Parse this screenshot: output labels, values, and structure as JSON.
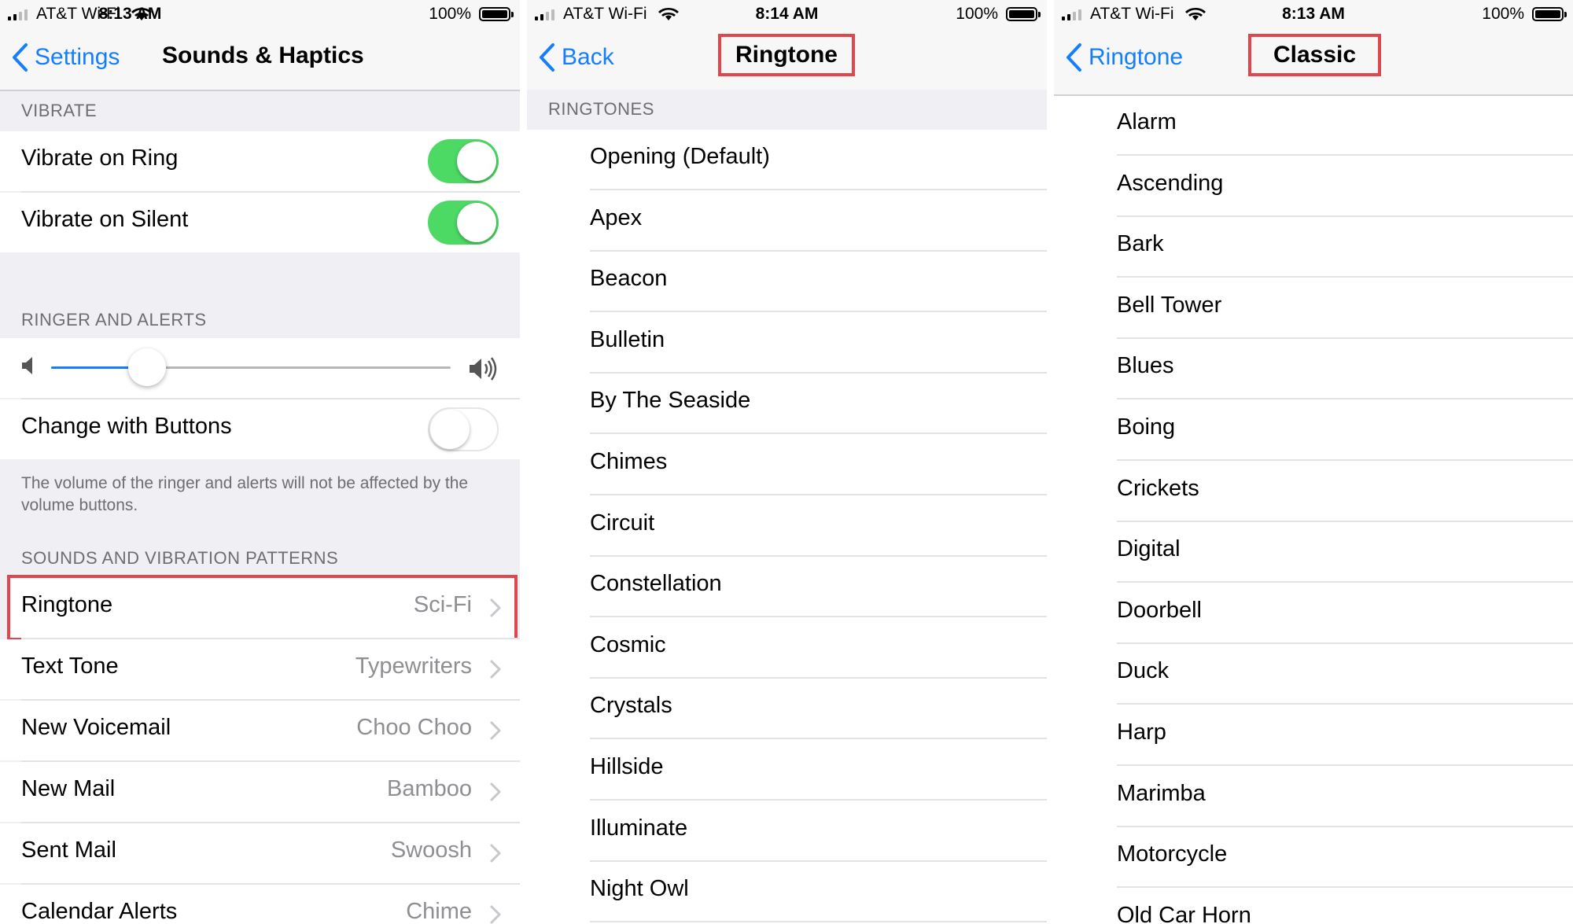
{
  "panels": [
    {
      "status": {
        "carrier": "AT&T Wi-Fi",
        "time": "8:13 AM",
        "battery": "100%"
      },
      "nav": {
        "back_label": "Settings",
        "title": "Sounds & Haptics"
      },
      "vibrate": {
        "header": "VIBRATE",
        "rows": [
          {
            "label": "Vibrate on Ring",
            "on": true
          },
          {
            "label": "Vibrate on Silent",
            "on": true
          }
        ]
      },
      "ringer": {
        "header": "RINGER AND ALERTS",
        "volume_level": 0.24,
        "change_with_buttons": {
          "label": "Change with Buttons",
          "on": false
        },
        "footnote": "The volume of the ringer and alerts will not be affected by the volume buttons."
      },
      "patterns": {
        "header": "SOUNDS AND VIBRATION PATTERNS",
        "rows": [
          {
            "label": "Ringtone",
            "value": "Sci-Fi",
            "highlighted": true
          },
          {
            "label": "Text Tone",
            "value": "Typewriters"
          },
          {
            "label": "New Voicemail",
            "value": "Choo Choo"
          },
          {
            "label": "New Mail",
            "value": "Bamboo"
          },
          {
            "label": "Sent Mail",
            "value": "Swoosh"
          },
          {
            "label": "Calendar Alerts",
            "value": "Chime"
          }
        ]
      }
    },
    {
      "status": {
        "carrier": "AT&T Wi-Fi",
        "time": "8:14 AM",
        "battery": "100%"
      },
      "nav": {
        "back_label": "Back",
        "title": "Ringtone"
      },
      "header": "RINGTONES",
      "items": [
        "Opening (Default)",
        "Apex",
        "Beacon",
        "Bulletin",
        "By The Seaside",
        "Chimes",
        "Circuit",
        "Constellation",
        "Cosmic",
        "Crystals",
        "Hillside",
        "Illuminate",
        "Night Owl"
      ]
    },
    {
      "status": {
        "carrier": "AT&T Wi-Fi",
        "time": "8:13 AM",
        "battery": "100%"
      },
      "nav": {
        "back_label": "Ringtone",
        "title": "Classic"
      },
      "items": [
        "Alarm",
        "Ascending",
        "Bark",
        "Bell Tower",
        "Blues",
        "Boing",
        "Crickets",
        "Digital",
        "Doorbell",
        "Duck",
        "Harp",
        "Marimba",
        "Motorcycle",
        "Old Car Horn"
      ]
    }
  ],
  "colors": {
    "accent": "#157efb",
    "toggle_on": "#4cd964",
    "highlight": "#e0474c"
  }
}
